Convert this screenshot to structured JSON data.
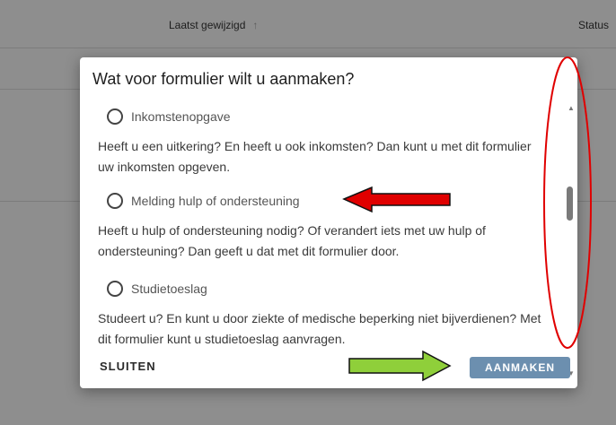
{
  "table": {
    "col_modified": "Laatst gewijzigd",
    "sort_icon": "arrow-up-icon",
    "sort_glyph": "↑",
    "col_status": "Status"
  },
  "dialog": {
    "title": "Wat voor formulier wilt u aanmaken?",
    "options": [
      {
        "label": "Inkomstenopgave",
        "description": "Heeft u een uitkering? En heeft u ook inkomsten? Dan kunt u met dit formulier uw inkomsten opgeven."
      },
      {
        "label": "Melding hulp of ondersteuning",
        "description": "Heeft u hulp of ondersteuning nodig? Of verandert iets met uw hulp of ondersteuning? Dan geeft u dat met dit formulier door."
      },
      {
        "label": "Studietoeslag",
        "description": "Studeert u? En kunt u door ziekte of medische beperking niet bijverdienen? Met dit formulier kunt u studietoeslag aanvragen."
      }
    ],
    "close_label": "SLUITEN",
    "create_label": "AANMAKEN",
    "scroll_up_glyph": "▲",
    "scroll_down_glyph": "▼"
  },
  "colors": {
    "create_button": "#6c8faf",
    "annotation_red": "#e00000",
    "annotation_green": "#8fcf3a"
  }
}
